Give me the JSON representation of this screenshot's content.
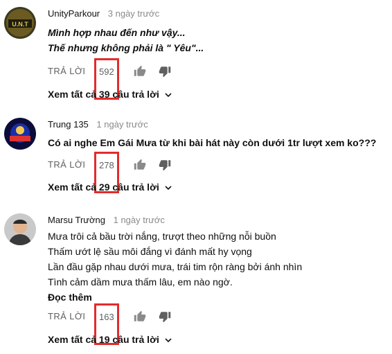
{
  "comments": [
    {
      "author": "UnityParkour",
      "time": "3 ngày trước",
      "lines": [
        "Mình hợp nhau đến như vậy...",
        "Thế nhưng không phải là \" Yêu\"..."
      ],
      "reply_label": "TRẢ LỜI",
      "like_count": "592",
      "view_replies": "Xem tất cả 39 câu trả lời",
      "avatar_text": "U.N.T"
    },
    {
      "author": "Trung 135",
      "time": "1 ngày trước",
      "lines": [
        "Có ai nghe Em Gái Mưa từ khi bài hát này còn dưới 1tr lượt xem ko???"
      ],
      "reply_label": "TRẢ LỜI",
      "like_count": "278",
      "view_replies": "Xem tất cả 29 câu trả lời"
    },
    {
      "author": "Marsu Trường",
      "time": "1 ngày trước",
      "lines": [
        "Mưa trôi cả bầu trời nắng, trượt theo những nỗi buồn",
        "Thấm ướt lệ sầu môi đắng vì đánh mất hy vọng",
        "Lần đầu gặp nhau dưới mưa, trái tim rộn ràng bởi ánh nhìn",
        "Tình cảm dầm mưa thấm lâu, em nào ngờ."
      ],
      "read_more": "Đọc thêm",
      "reply_label": "TRẢ LỜI",
      "like_count": "163",
      "view_replies": "Xem tất cả 19 câu trả lời"
    }
  ],
  "colors": {
    "highlight": "#e22b2b",
    "meta_gray": "#8a8a8a",
    "action_gray": "#606060"
  },
  "icons": [
    "thumbs-up-icon",
    "thumbs-down-icon",
    "chevron-down-icon"
  ]
}
